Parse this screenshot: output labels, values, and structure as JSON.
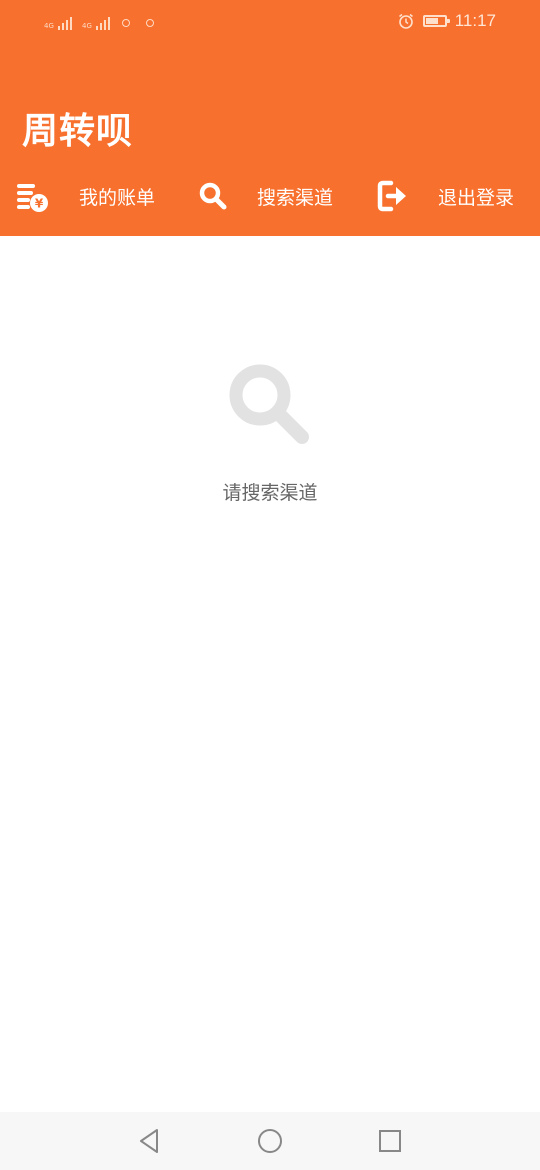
{
  "status_bar": {
    "network_1": "4G",
    "network_2": "4G",
    "time": "11:17",
    "battery_percent": 70
  },
  "header": {
    "app_title": "周转呗",
    "background_color": "#f7702d"
  },
  "nav": {
    "bill_label": "我的账单",
    "search_label": "搜索渠道",
    "logout_label": "退出登录"
  },
  "main": {
    "empty_text": "请搜索渠道",
    "icon": "search-icon"
  }
}
